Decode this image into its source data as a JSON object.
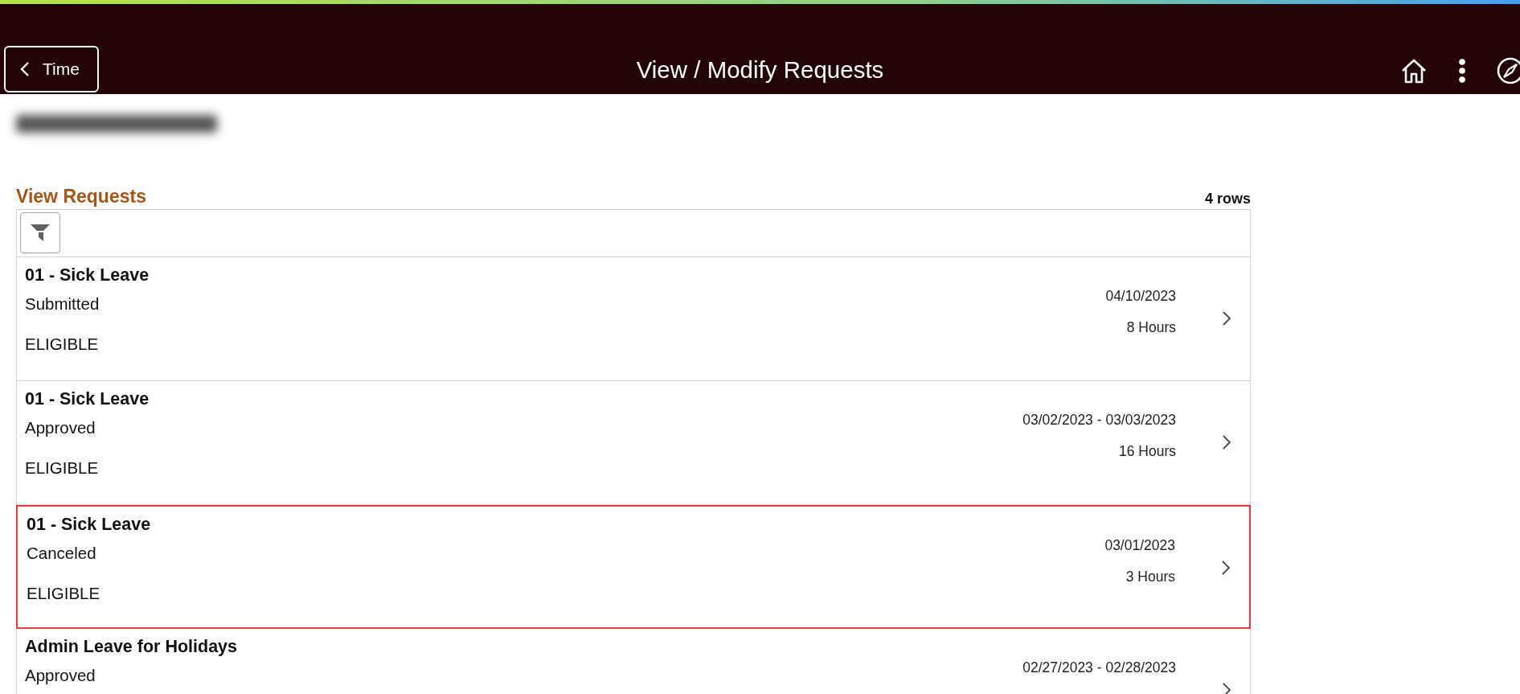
{
  "header": {
    "back_label": "Time",
    "title": "View / Modify Requests"
  },
  "section": {
    "title": "View Requests",
    "row_count": "4 rows"
  },
  "rows": [
    {
      "title": "01 - Sick Leave",
      "status": "Submitted",
      "eligibility": "ELIGIBLE",
      "dates": "04/10/2023",
      "hours": "8 Hours",
      "selected": false
    },
    {
      "title": "01 - Sick Leave",
      "status": "Approved",
      "eligibility": "ELIGIBLE",
      "dates": "03/02/2023 - 03/03/2023",
      "hours": "16 Hours",
      "selected": false
    },
    {
      "title": "01 - Sick Leave",
      "status": "Canceled",
      "eligibility": "ELIGIBLE",
      "dates": "03/01/2023",
      "hours": "3 Hours",
      "selected": true
    },
    {
      "title": "Admin Leave for Holidays",
      "status": "Approved",
      "dates": "02/27/2023 - 02/28/2023",
      "selected": false
    }
  ]
}
